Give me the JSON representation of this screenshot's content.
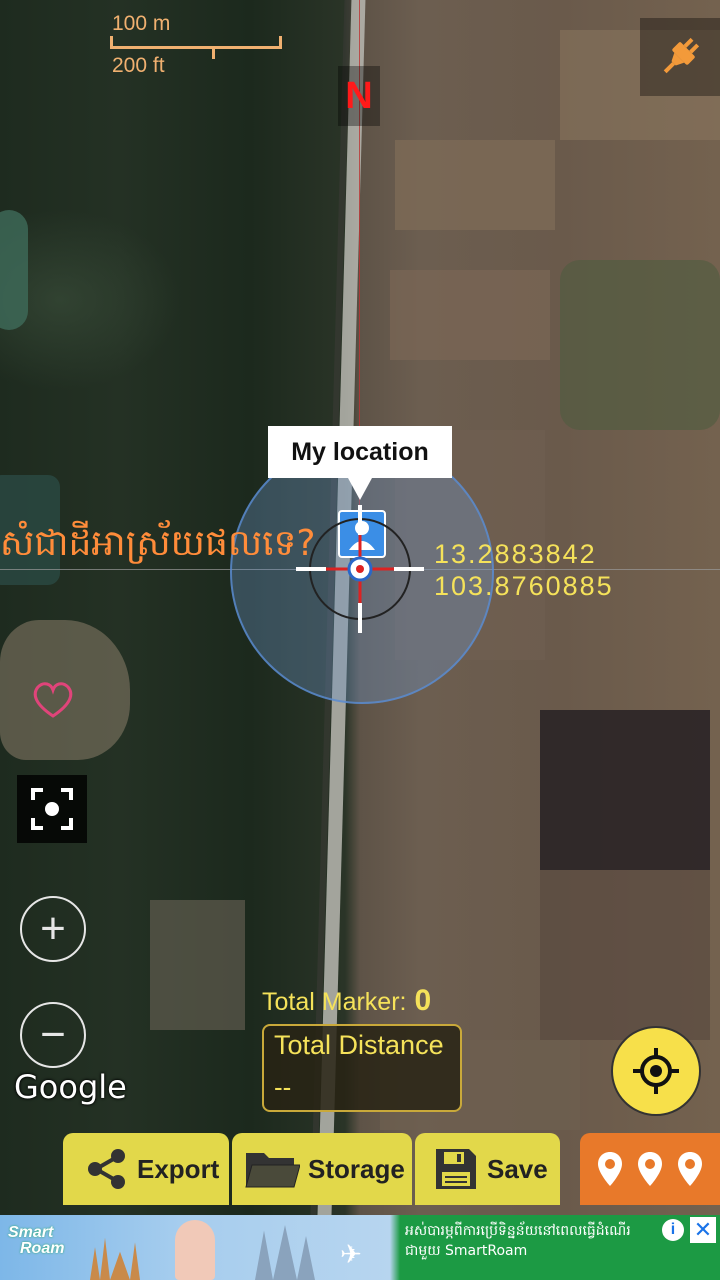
{
  "scale": {
    "metric": "100 m",
    "imperial": "200 ft"
  },
  "compass": {
    "north_label": "N"
  },
  "location": {
    "callout": "My location",
    "latitude": "13.2883842",
    "longitude": "103.8760885"
  },
  "overlay_text": "សំជាដីអាស្រ័យផលទេ?",
  "map_attribution": "Google",
  "zoom": {
    "in": "+",
    "out": "−"
  },
  "totals": {
    "marker_label": "Total Marker:",
    "marker_count": "0",
    "distance_label": "Total Distance",
    "distance_value": "--"
  },
  "toolbar": {
    "export": "Export",
    "storage": "Storage",
    "save": "Save"
  },
  "ad": {
    "brand_line1": "Smart",
    "brand_line2": "Roam",
    "text_line1": "អស់បារម្ភពីការប្រើទិន្នន័យនៅពេលធ្វើដំណើរ",
    "text_line2": "ជាមួយ SmartRoam",
    "info": "i",
    "close": "✕"
  },
  "colors": {
    "accent_yellow": "#f5e25a",
    "toolbar_yellow": "#e2d84a",
    "markers_orange": "#e8792a",
    "north_red": "#ff1a1a",
    "overlay_orange": "#ff8c3a"
  }
}
